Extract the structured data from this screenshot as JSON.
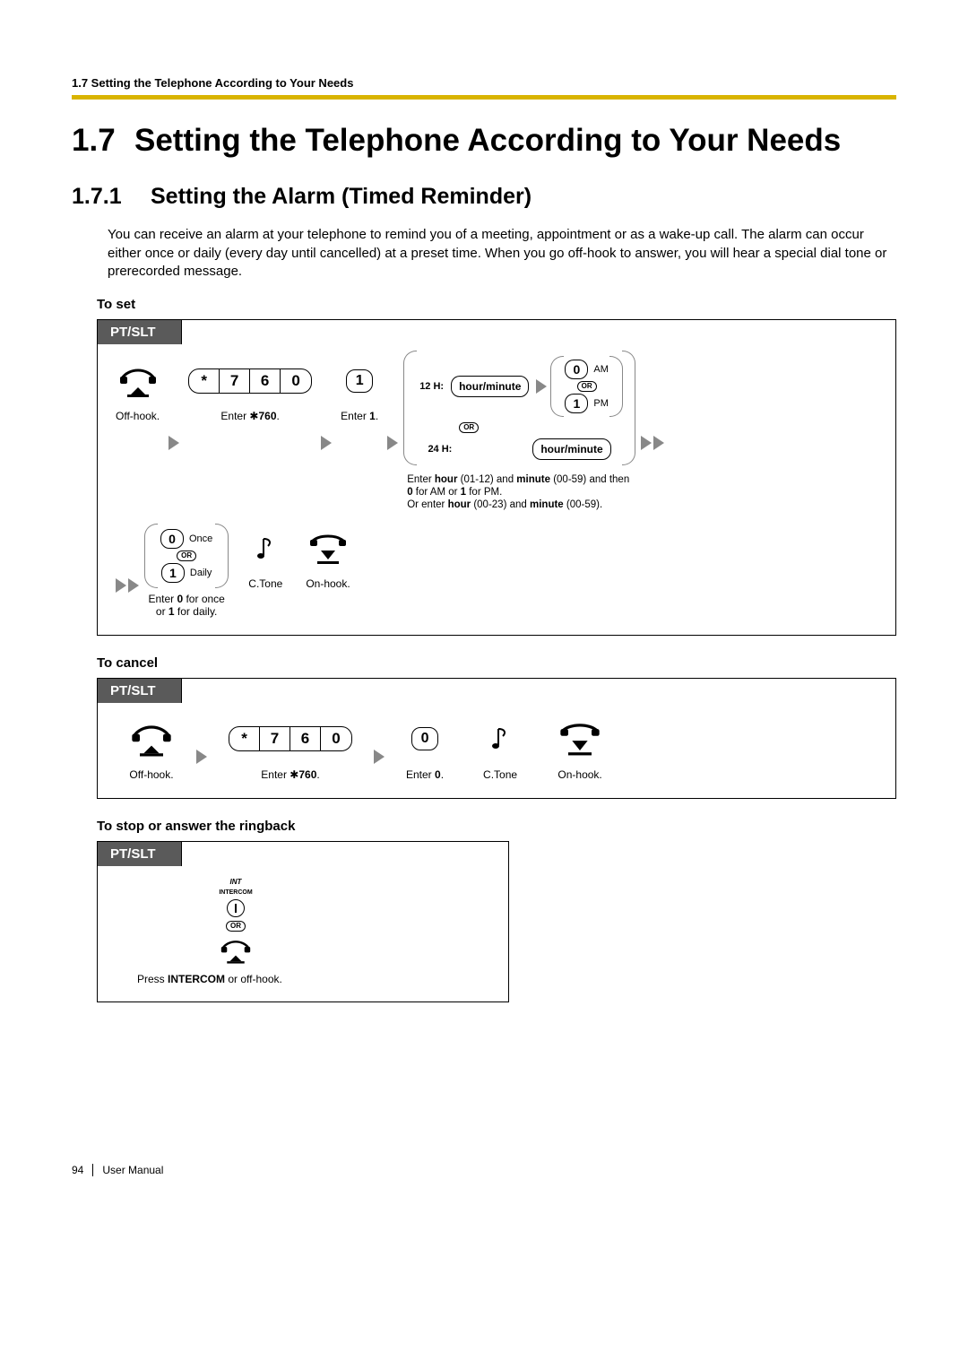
{
  "header": {
    "running": "1.7 Setting the Telephone According to Your Needs"
  },
  "section": {
    "num": "1.7",
    "title": "Setting the Telephone According to Your Needs"
  },
  "subsection": {
    "num": "1.7.1",
    "title": "Setting the Alarm (Timed Reminder)"
  },
  "intro": "You can receive an alarm at your telephone to remind you of a meeting, appointment or as a wake-up call. The alarm can occur either once or daily (every day until cancelled) at a preset time. When you go off-hook to answer, you will hear a special dial tone or prerecorded message.",
  "procedures": {
    "set": {
      "title": "To set",
      "tab": "PT/SLT",
      "keys": [
        "*",
        "7",
        "6",
        "0"
      ],
      "enter_keys_label_pre": "Enter ",
      "enter_keys_label_star": "*",
      "enter_keys_label_post": "760",
      "one_key": "1",
      "enter1_pre": "Enter ",
      "enter1_val": "1",
      "offhook": "Off-hook.",
      "h12": "12 H:",
      "h24": "24 H:",
      "hourmin": "hour/minute",
      "am_key": "0",
      "am": "AM",
      "pm_key": "1",
      "pm": "PM",
      "or": "OR",
      "time_note_l1_a": "Enter ",
      "time_note_l1_b": "hour",
      "time_note_l1_c": " (01-12) and ",
      "time_note_l1_d": "minute",
      "time_note_l1_e": " (00-59) and then",
      "time_note_l2_a": "0",
      "time_note_l2_b": " for AM or ",
      "time_note_l2_c": "1",
      "time_note_l2_d": " for PM.",
      "time_note_l3_a": "Or enter ",
      "time_note_l3_b": "hour",
      "time_note_l3_c": " (00-23) and ",
      "time_note_l3_d": "minute",
      "time_note_l3_e": " (00-59).",
      "once_key": "0",
      "once": "Once",
      "daily_key": "1",
      "daily": "Daily",
      "freq_note_a": "Enter ",
      "freq_note_b": "0",
      "freq_note_c": " for once",
      "freq_note_d": "or ",
      "freq_note_e": "1",
      "freq_note_f": " for daily.",
      "ctone": "C.Tone",
      "onhook": "On-hook."
    },
    "cancel": {
      "title": "To cancel",
      "tab": "PT/SLT",
      "keys": [
        "*",
        "7",
        "6",
        "0"
      ],
      "offhook": "Off-hook.",
      "enter_keys_label_pre": "Enter ",
      "enter_keys_label_star": "*",
      "enter_keys_label_post": "760",
      "zero": "0",
      "enter0_pre": "Enter ",
      "enter0_val": "0",
      "ctone": "C.Tone",
      "onhook": "On-hook."
    },
    "stop": {
      "title": "To stop or answer the ringback",
      "tab": "PT/SLT",
      "int_label": "INT",
      "intercom_label": "INTERCOM",
      "or": "OR",
      "caption_a": "Press ",
      "caption_b": "INTERCOM",
      "caption_c": " or off-hook."
    }
  },
  "footer": {
    "page": "94",
    "manual": "User Manual"
  },
  "period": "."
}
